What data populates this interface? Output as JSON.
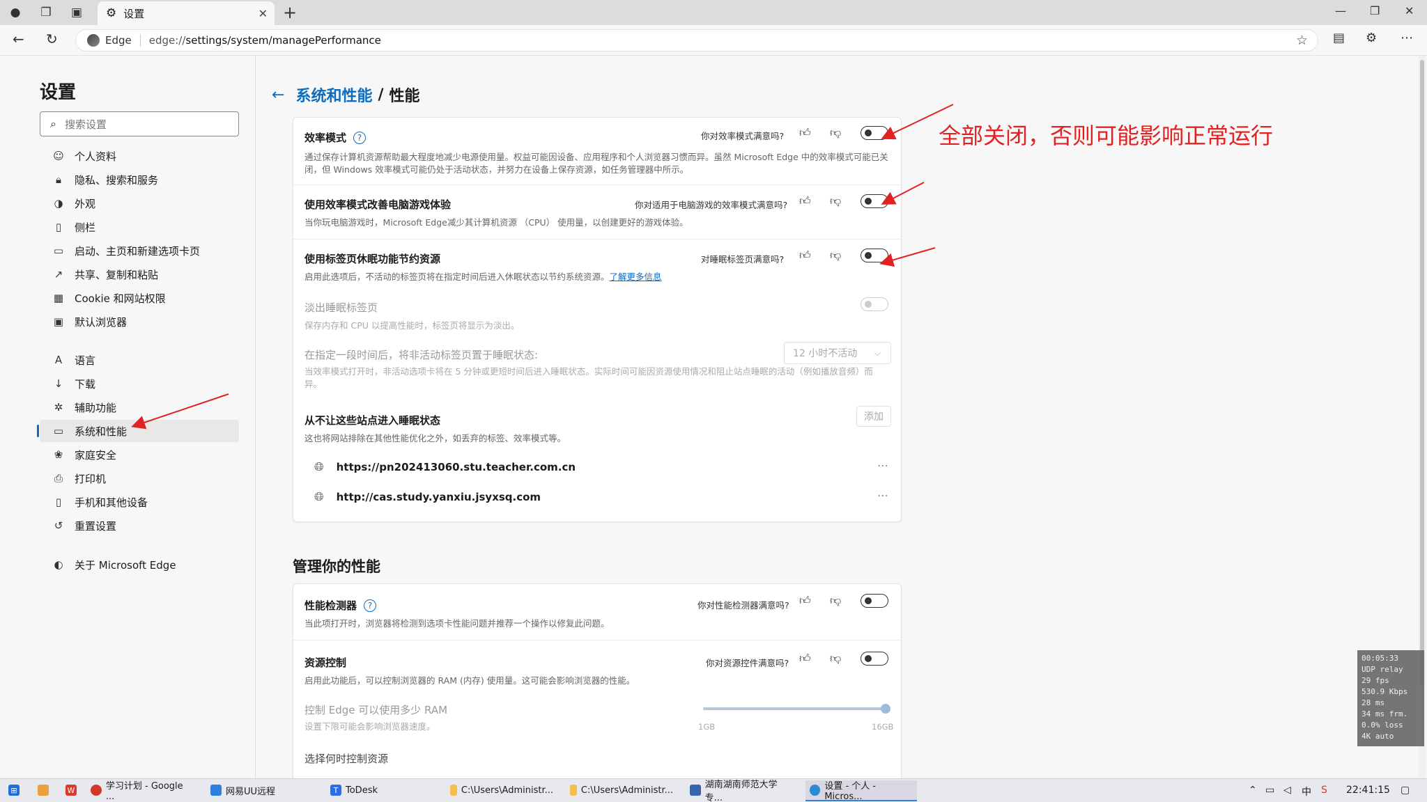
{
  "browser": {
    "tab_title": "设置",
    "site_name": "Edge",
    "url_prefix": "edge://",
    "url_path": "settings/system/managePerformance"
  },
  "sidebar": {
    "title": "设置",
    "search_placeholder": "搜索设置",
    "items": [
      {
        "label": "个人资料",
        "icon": "profile-icon"
      },
      {
        "label": "隐私、搜索和服务",
        "icon": "lock-icon"
      },
      {
        "label": "外观",
        "icon": "appearance-icon"
      },
      {
        "label": "侧栏",
        "icon": "sidebar-icon"
      },
      {
        "label": "启动、主页和新建选项卡页",
        "icon": "start-icon"
      },
      {
        "label": "共享、复制和粘贴",
        "icon": "share-icon"
      },
      {
        "label": "Cookie 和网站权限",
        "icon": "cookie-icon"
      },
      {
        "label": "默认浏览器",
        "icon": "browser-icon"
      },
      {
        "label": "语言",
        "icon": "language-icon"
      },
      {
        "label": "下载",
        "icon": "download-icon"
      },
      {
        "label": "辅助功能",
        "icon": "accessibility-icon"
      },
      {
        "label": "系统和性能",
        "icon": "system-icon"
      },
      {
        "label": "家庭安全",
        "icon": "family-icon"
      },
      {
        "label": "打印机",
        "icon": "printer-icon"
      },
      {
        "label": "手机和其他设备",
        "icon": "phone-icon"
      },
      {
        "label": "重置设置",
        "icon": "reset-icon"
      },
      {
        "label": "关于 Microsoft Edge",
        "icon": "edge-icon"
      }
    ]
  },
  "breadcrumb": {
    "parent": "系统和性能",
    "separator": "/",
    "current": "性能"
  },
  "performance": {
    "efficiency": {
      "title": "效率模式",
      "question": "你对效率模式满意吗?",
      "desc": "通过保存计算机资源帮助最大程度地减少电源使用量。权益可能因设备、应用程序和个人浏览器习惯而异。虽然 Microsoft Edge 中的效率模式可能已关闭，但 Windows 效率模式可能仍处于活动状态，并努力在设备上保存资源，如任务管理器中所示。"
    },
    "gaming": {
      "title": "使用效率模式改善电脑游戏体验",
      "question": "你对适用于电脑游戏的效率模式满意吗?",
      "desc": "当你玩电脑游戏时，Microsoft Edge减少其计算机资源 （CPU） 使用量，以创建更好的游戏体验。"
    },
    "sleeping": {
      "title": "使用标签页休眠功能节约资源",
      "question": "对睡眠标签页满意吗?",
      "desc": "启用此选项后，不活动的标签页将在指定时间后进入休眠状态以节约系统资源。",
      "link": "了解更多信息"
    },
    "fade": {
      "title": "淡出睡眠标签页",
      "desc": "保存内存和 CPU 以提高性能时，标签页将显示为淡出。"
    },
    "timer": {
      "title": "在指定一段时间后，将非活动标签页置于睡眠状态:",
      "value": "12 小时不活动",
      "desc": "当效率模式打开时，非活动选项卡将在 5 分钟或更短时间后进入睡眠状态。实际时间可能因资源使用情况和阻止站点睡眠的活动（例如播放音频）而异。"
    },
    "never_sleep": {
      "title": "从不让这些站点进入睡眠状态",
      "add_label": "添加",
      "desc": "这也将网站排除在其他性能优化之外，如丢弃的标签、效率模式等。",
      "sites": [
        "https://pn202413060.stu.teacher.com.cn",
        "http://cas.study.yanxiu.jsyxsq.com"
      ]
    }
  },
  "manage": {
    "section_title": "管理你的性能",
    "detector": {
      "title": "性能检测器",
      "question": "你对性能检测器满意吗?",
      "desc": "当此项打开时，浏览器将检测到选项卡性能问题并推荐一个操作以修复此问题。"
    },
    "resource": {
      "title": "资源控制",
      "question": "你对资源控件满意吗?",
      "desc": "启用此功能后，可以控制浏览器的 RAM (内存) 使用量。这可能会影响浏览器的性能。"
    },
    "ram": {
      "title": "控制 Edge 可以使用多少 RAM",
      "desc": "设置下限可能会影响浏览器速度。",
      "min_label": "1GB",
      "max_label": "16GB",
      "level": 1.0
    },
    "when": {
      "title": "选择何时控制资源"
    }
  },
  "annotation": {
    "text": "全部关闭，否则可能影响正常运行",
    "color": "#e22222"
  },
  "stats_overlay": {
    "lines": [
      "00:05:33",
      "UDP relay",
      "29 fps",
      "530.9 Kbps",
      "28 ms",
      "34 ms frm.",
      "0.0% loss",
      "4K auto"
    ]
  },
  "taskbar": {
    "apps": [
      {
        "label": "学习计划 - Google ...",
        "icon": "chrome-icon"
      },
      {
        "label": "网易UU远程",
        "icon": "uu-icon"
      },
      {
        "label": "ToDesk",
        "icon": "todesk-icon"
      },
      {
        "label": "C:\\Users\\Administr...",
        "icon": "folder-icon"
      },
      {
        "label": "C:\\Users\\Administr...",
        "icon": "folder-icon"
      },
      {
        "label": "湖南湖南师范大学专...",
        "icon": "app-icon"
      },
      {
        "label": "设置 - 个人 - Micros...",
        "icon": "edge-icon"
      }
    ],
    "ime": "中",
    "time": "22:41:15"
  }
}
